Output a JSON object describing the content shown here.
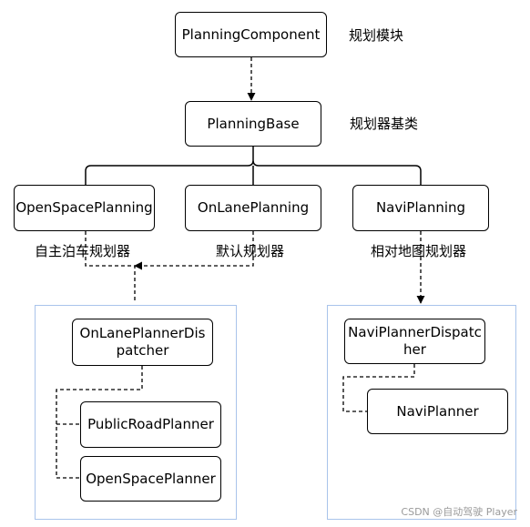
{
  "colors": {
    "node_border": "#000000",
    "group_border": "#a9c4eb",
    "watermark": "#9a9a9a"
  },
  "nodes": {
    "planning_component": "PlanningComponent",
    "planning_base": "PlanningBase",
    "open_space_planning": "OpenSpacePlanning",
    "on_lane_planning": "OnLanePlanning",
    "navi_planning": "NaviPlanning",
    "on_lane_planner_dispatcher": "OnLanePlannerDispatcher",
    "public_road_planner": "PublicRoadPlanner",
    "open_space_planner": "OpenSpacePlanner",
    "navi_planner_dispatcher": "NaviPlannerDispatcher",
    "navi_planner": "NaviPlanner"
  },
  "annotations": {
    "planning_module": "规划模块",
    "planner_base_class": "规划器基类",
    "autonomous_parking_planner": "自主泊车规划器",
    "default_planner": "默认规划器",
    "relative_map_planner": "相对地图规划器"
  },
  "watermark": "CSDN @自动驾驶 Player"
}
